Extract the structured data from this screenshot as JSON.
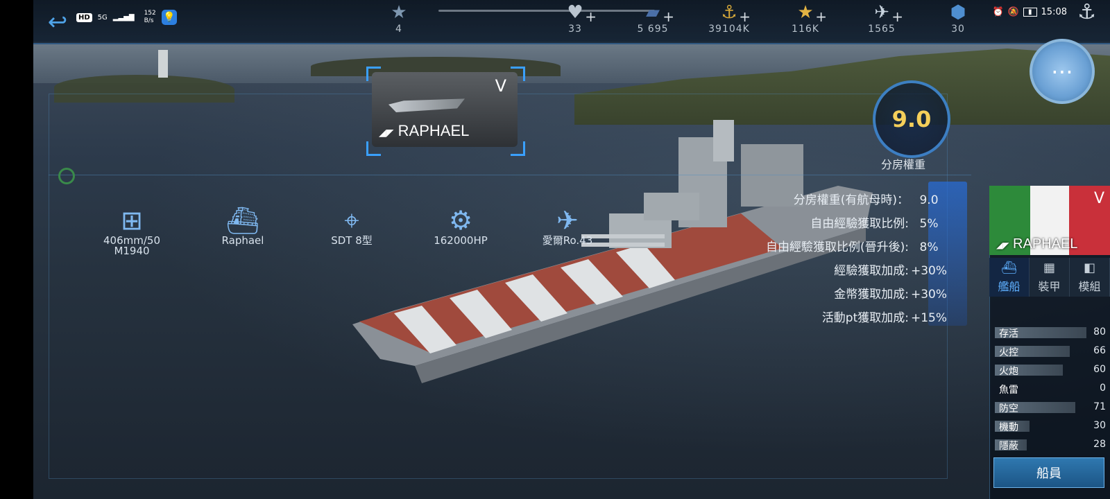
{
  "topbar": {
    "status": {
      "hd": "HD",
      "net": "5G",
      "speed_top": "152",
      "speed_bottom": "B/s"
    },
    "resources": [
      {
        "icon": "rank-icon",
        "glyph": "★",
        "value": "4"
      },
      {
        "icon": "heart-icon",
        "glyph": "♥",
        "value": "33"
      },
      {
        "icon": "card-icon",
        "glyph": "▰",
        "value": "5 695"
      },
      {
        "icon": "anchor-coin-icon",
        "glyph": "⚓",
        "value": "39104K"
      },
      {
        "icon": "star-icon",
        "glyph": "★",
        "value": "116K"
      },
      {
        "icon": "plane-icon",
        "glyph": "✈",
        "value": "1565"
      },
      {
        "icon": "badge-icon",
        "glyph": "⬢",
        "value": "30"
      }
    ],
    "clock": "15:08"
  },
  "ship_card": {
    "tier": "V",
    "name": "RAPHAEL"
  },
  "weight": {
    "value": "9.0",
    "label": "分房權重"
  },
  "stats": [
    {
      "label": "分房權重(有航母時)：",
      "value": "9.0"
    },
    {
      "label": "自由經驗獲取比例:",
      "value": "5%"
    },
    {
      "label": "自由經驗獲取比例(晉升後):",
      "value": "8%"
    },
    {
      "label": "經驗獲取加成:",
      "value": "+30%"
    },
    {
      "label": "金幣獲取加成:",
      "value": "+30%"
    },
    {
      "label": "活動pt獲取加成:",
      "value": "+15%"
    }
  ],
  "equipment": [
    {
      "icon": "gun-icon",
      "glyph": "⊞",
      "label": "406mm/50 M1940"
    },
    {
      "icon": "hull-icon",
      "glyph": "⛴",
      "label": "Raphael"
    },
    {
      "icon": "radar-icon",
      "glyph": "⌖",
      "label": "SDT 8型"
    },
    {
      "icon": "engine-icon",
      "glyph": "⚙",
      "label": "162000HP"
    },
    {
      "icon": "seaplane-icon",
      "glyph": "✈",
      "label": "愛爾Ro.43"
    }
  ],
  "panel": {
    "tier": "V",
    "name": "RAPHAEL",
    "tabs": [
      {
        "icon": "ship-tab-icon",
        "glyph": "⛴",
        "label": "艦船"
      },
      {
        "icon": "armor-tab-icon",
        "glyph": "▦",
        "label": "裝甲"
      },
      {
        "icon": "module-tab-icon",
        "glyph": "◧",
        "label": "模組"
      }
    ],
    "attributes": [
      {
        "label": "存活",
        "value": "80"
      },
      {
        "label": "火控",
        "value": "66"
      },
      {
        "label": "火炮",
        "value": "60"
      },
      {
        "label": "魚雷",
        "value": "0"
      },
      {
        "label": "防空",
        "value": "71"
      },
      {
        "label": "機動",
        "value": "30"
      },
      {
        "label": "隱蔽",
        "value": "28"
      }
    ],
    "crew_button": "船員"
  }
}
